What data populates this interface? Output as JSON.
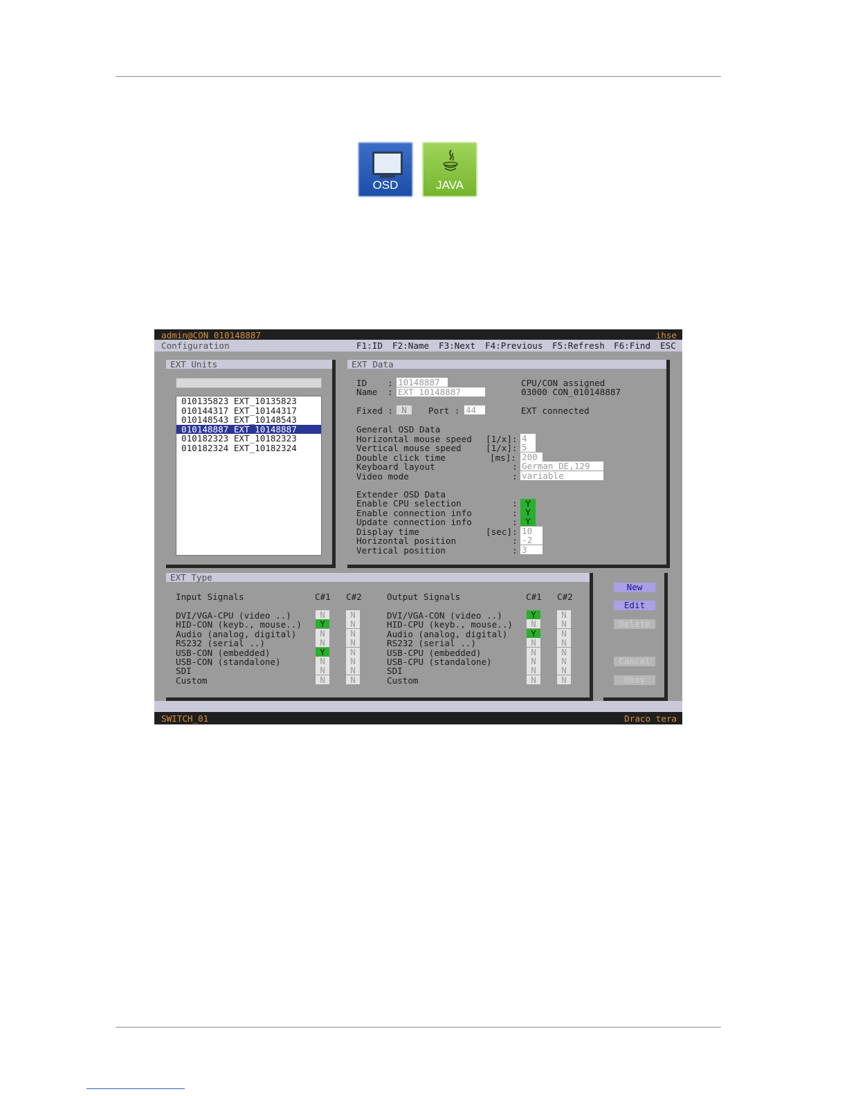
{
  "badges": {
    "osd": "OSD",
    "java": "JAVA"
  },
  "osd": {
    "user": "admin@CON 010148887",
    "brand": "ihse",
    "menu_title": "Configuration",
    "fkeys": [
      "F1:ID",
      "F2:Name",
      "F3:Next",
      "F4:Previous",
      "F5:Refresh",
      "F6:Find",
      "ESC"
    ],
    "ext_units": {
      "title": "EXT Units",
      "items": [
        "010135823 EXT_10135823",
        "010144317 EXT_10144317",
        "010148543 EXT_10148543",
        "010148887 EXT_10148887",
        "010182323 EXT_10182323",
        "010182324 EXT_10182324"
      ]
    },
    "ext_data": {
      "title": "EXT Data",
      "id_label": "ID",
      "id_value": "10148887",
      "name_label": "Name",
      "name_value": "EXT_10148887",
      "sep": ":",
      "fixed_label": "Fixed :",
      "fixed_value": "N",
      "port_label": "Port :",
      "port_value": "44",
      "cpucon_label": "CPU/CON assigned",
      "cpucon_value": "03000 CON_010148887",
      "ext_status": "EXT connected",
      "general_heading": "General OSD Data",
      "h_speed_label": "Horizontal mouse speed",
      "h_speed_unit": "[1/x]:",
      "h_speed_value": "4",
      "v_speed_label": "Vertical mouse speed",
      "v_speed_unit": "[1/x]:",
      "v_speed_value": "5",
      "dbl_label": "Double click time",
      "dbl_unit": "[ms]:",
      "dbl_value": "200",
      "kbd_label": "Keyboard layout",
      "kbd_value": "German DE,129",
      "video_label": "Video mode",
      "video_value": "variable",
      "extender_heading": "Extender OSD Data",
      "cpu_sel_label": "Enable CPU selection",
      "cpu_sel_value": "Y",
      "conn_info_label": "Enable connection info",
      "conn_info_value": "Y",
      "upd_info_label": "Update connection info",
      "upd_info_value": "Y",
      "disp_label": "Display time",
      "disp_unit": "[sec]:",
      "disp_value": "10",
      "hpos_label": "Horizontal position",
      "hpos_value": "-2",
      "vpos_label": "Vertical position",
      "vpos_value": "3"
    },
    "ext_type": {
      "title": "EXT Type",
      "input_heading": "Input Signals",
      "output_heading": "Output Signals",
      "c1": "C#1",
      "c2": "C#2",
      "inputs": [
        {
          "label": "DVI/VGA-CPU (video ..)",
          "c1": "N",
          "c2": "N"
        },
        {
          "label": "HID-CON (keyb., mouse..)",
          "c1": "Y",
          "c2": "N"
        },
        {
          "label": "Audio (analog, digital)",
          "c1": "N",
          "c2": "N"
        },
        {
          "label": "RS232 (serial ..)",
          "c1": "N",
          "c2": "N"
        },
        {
          "label": "USB-CON (embedded)",
          "c1": "Y",
          "c2": "N"
        },
        {
          "label": "USB-CON (standalone)",
          "c1": "N",
          "c2": "N"
        },
        {
          "label": "SDI",
          "c1": "N",
          "c2": "N"
        },
        {
          "label": "Custom",
          "c1": "N",
          "c2": "N"
        }
      ],
      "outputs": [
        {
          "label": "DVI/VGA-CON (video ..)",
          "c1": "Y",
          "c2": "N"
        },
        {
          "label": "HID-CPU (keyb., mouse..)",
          "c1": "N",
          "c2": "N"
        },
        {
          "label": "Audio (analog, digital)",
          "c1": "Y",
          "c2": "N"
        },
        {
          "label": "RS232 (serial ..)",
          "c1": "N",
          "c2": "N"
        },
        {
          "label": "USB-CPU (embedded)",
          "c1": "N",
          "c2": "N"
        },
        {
          "label": "USB-CPU (standalone)",
          "c1": "N",
          "c2": "N"
        },
        {
          "label": "SDI",
          "c1": "N",
          "c2": "N"
        },
        {
          "label": "Custom",
          "c1": "N",
          "c2": "N"
        }
      ]
    },
    "buttons": {
      "new": "New",
      "edit": "Edit",
      "delete": "Delete",
      "cancel": "Cancel",
      "okay": "Okay"
    },
    "status_left": "SWITCH_01",
    "status_right": "Draco tera"
  }
}
